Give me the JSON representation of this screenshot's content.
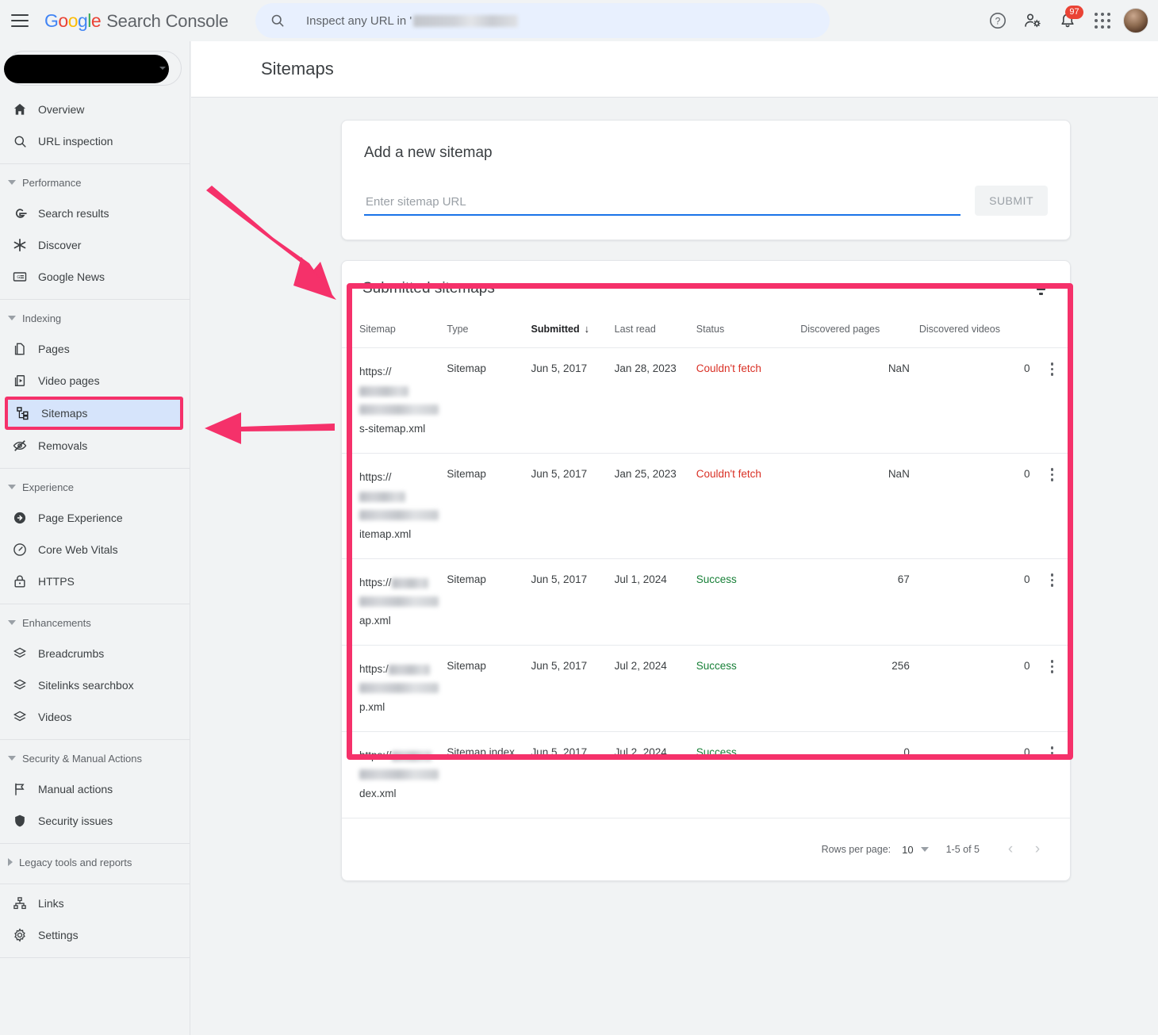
{
  "header": {
    "brand_google": "Google",
    "brand_name": "Search Console",
    "search_placeholder_prefix": "Inspect any URL in '",
    "notification_count": "97",
    "icons": [
      "menu-icon",
      "search-icon",
      "help-icon",
      "account-settings-icon",
      "notifications-icon",
      "apps-grid-icon",
      "avatar"
    ]
  },
  "sidebar": {
    "property_selector_label": "",
    "items": [
      {
        "label": "Overview",
        "icon": "home-icon",
        "type": "item"
      },
      {
        "label": "URL inspection",
        "icon": "search-icon",
        "type": "item"
      },
      {
        "label": "Performance",
        "icon": "chevron-down-icon",
        "type": "group"
      },
      {
        "label": "Search results",
        "icon": "google-g-icon",
        "type": "item"
      },
      {
        "label": "Discover",
        "icon": "discover-asterisk-icon",
        "type": "item"
      },
      {
        "label": "Google News",
        "icon": "google-news-icon",
        "type": "item"
      },
      {
        "label": "Indexing",
        "icon": "chevron-down-icon",
        "type": "group"
      },
      {
        "label": "Pages",
        "icon": "pages-copy-icon",
        "type": "item"
      },
      {
        "label": "Video pages",
        "icon": "video-pages-icon",
        "type": "item"
      },
      {
        "label": "Sitemaps",
        "icon": "sitemaps-hierarchy-icon",
        "type": "item",
        "active": true
      },
      {
        "label": "Removals",
        "icon": "eye-off-icon",
        "type": "item"
      },
      {
        "label": "Experience",
        "icon": "chevron-down-icon",
        "type": "group"
      },
      {
        "label": "Page Experience",
        "icon": "page-experience-icon",
        "type": "item"
      },
      {
        "label": "Core Web Vitals",
        "icon": "speedometer-icon",
        "type": "item"
      },
      {
        "label": "HTTPS",
        "icon": "lock-icon",
        "type": "item"
      },
      {
        "label": "Enhancements",
        "icon": "chevron-down-icon",
        "type": "group"
      },
      {
        "label": "Breadcrumbs",
        "icon": "layers-icon",
        "type": "item"
      },
      {
        "label": "Sitelinks searchbox",
        "icon": "layers-icon",
        "type": "item"
      },
      {
        "label": "Videos",
        "icon": "layers-icon",
        "type": "item"
      },
      {
        "label": "Security & Manual Actions",
        "icon": "chevron-down-icon",
        "type": "group"
      },
      {
        "label": "Manual actions",
        "icon": "flag-icon",
        "type": "item"
      },
      {
        "label": "Security issues",
        "icon": "shield-icon",
        "type": "item"
      },
      {
        "label": "Legacy tools and reports",
        "icon": "chevron-right-icon",
        "type": "group-collapsed"
      },
      {
        "label": "Links",
        "icon": "links-hierarchy-icon",
        "type": "item"
      },
      {
        "label": "Settings",
        "icon": "gear-icon",
        "type": "item"
      }
    ]
  },
  "page": {
    "title": "Sitemaps"
  },
  "add_sitemap": {
    "title": "Add a new sitemap",
    "input_placeholder": "Enter sitemap URL",
    "input_value": "",
    "submit_label": "SUBMIT"
  },
  "submitted": {
    "title": "Submitted sitemaps",
    "filter_icon": "filter-icon",
    "columns": [
      "Sitemap",
      "Type",
      "Submitted",
      "Last read",
      "Status",
      "Discovered pages",
      "Discovered videos"
    ],
    "sort_column": "Submitted",
    "sort_direction": "descending",
    "sort_arrow": "↓",
    "rows": [
      {
        "sitemap_prefix": "https://",
        "sitemap_suffix": "s-sitemap.xml",
        "type": "Sitemap",
        "submitted": "Jun 5, 2017",
        "last_read": "Jan 28, 2023",
        "status": "Couldn't fetch",
        "status_kind": "fail",
        "discovered_pages": "NaN",
        "discovered_videos": "0"
      },
      {
        "sitemap_prefix": "https://",
        "sitemap_suffix": "itemap.xml",
        "type": "Sitemap",
        "submitted": "Jun 5, 2017",
        "last_read": "Jan 25, 2023",
        "status": "Couldn't fetch",
        "status_kind": "fail",
        "discovered_pages": "NaN",
        "discovered_videos": "0"
      },
      {
        "sitemap_prefix": "https://",
        "sitemap_suffix": "ap.xml",
        "type": "Sitemap",
        "submitted": "Jun 5, 2017",
        "last_read": "Jul 1, 2024",
        "status": "Success",
        "status_kind": "ok",
        "discovered_pages": "67",
        "discovered_videos": "0"
      },
      {
        "sitemap_prefix": "https:/",
        "sitemap_suffix": "p.xml",
        "type": "Sitemap",
        "submitted": "Jun 5, 2017",
        "last_read": "Jul 2, 2024",
        "status": "Success",
        "status_kind": "ok",
        "discovered_pages": "256",
        "discovered_videos": "0"
      },
      {
        "sitemap_prefix": "https://",
        "sitemap_suffix": "dex.xml",
        "type": "Sitemap index",
        "submitted": "Jun 5, 2017",
        "last_read": "Jul 2, 2024",
        "status": "Success",
        "status_kind": "ok",
        "discovered_pages": "0",
        "discovered_videos": "0"
      }
    ],
    "pagination": {
      "rows_per_page_label": "Rows per page:",
      "rows_per_page_value": "10",
      "range": "1-5 of 5",
      "prev": "‹",
      "next": "›"
    }
  },
  "annotations": {
    "color": "#f5316a",
    "arrow_to_table": "arrow pointing down-right at submitted sitemaps table",
    "arrow_to_sitemaps": "arrow pointing left at Sitemaps nav item",
    "box_table": "highlight box around submitted sitemaps table",
    "box_sitemaps": "highlight box around Sitemaps nav item"
  }
}
